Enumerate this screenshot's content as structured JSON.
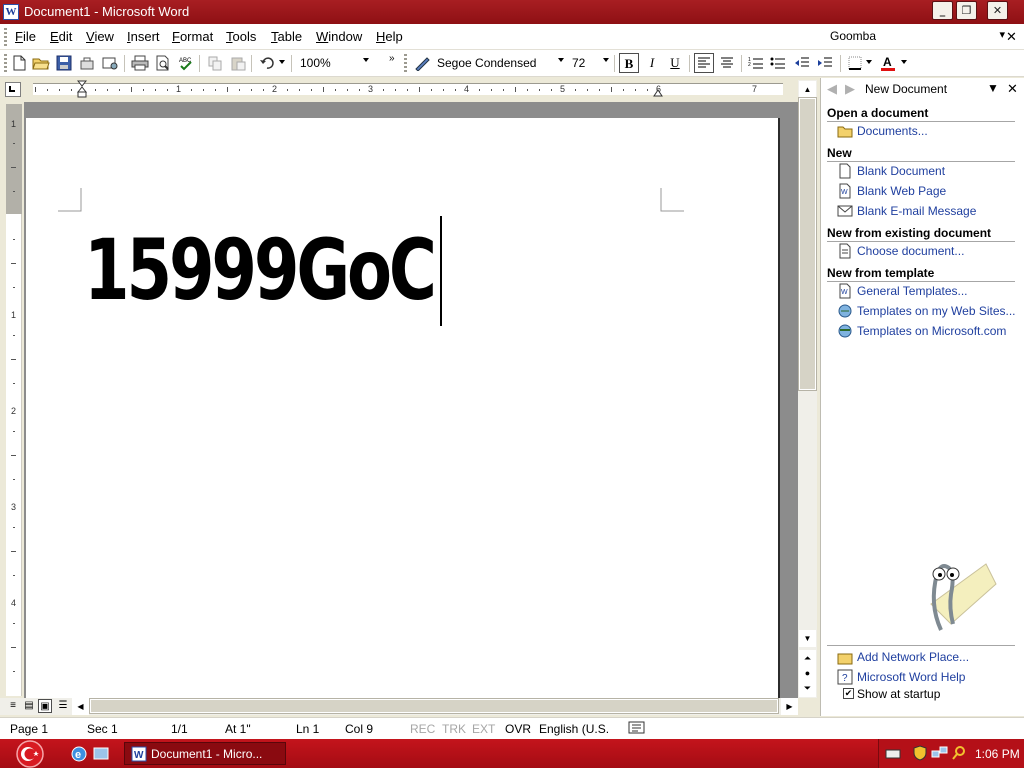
{
  "window": {
    "title": "Document1 - Microsoft Word",
    "app_icon": "W"
  },
  "menu": {
    "items": [
      "File",
      "Edit",
      "View",
      "Insert",
      "Format",
      "Tools",
      "Table",
      "Window",
      "Help"
    ],
    "help_box_value": "Goomba"
  },
  "toolbar": {
    "zoom": "100%",
    "font_name": "Segoe Condensed",
    "font_size": "72",
    "bold_label": "B",
    "italic_label": "I",
    "underline_label": "U"
  },
  "ruler": {
    "numbers": [
      "1",
      "2",
      "3",
      "4",
      "5",
      "6",
      "7"
    ],
    "vnumbers": [
      "1",
      "1",
      "2",
      "3",
      "4"
    ]
  },
  "document": {
    "text": "15999GoC"
  },
  "taskpane": {
    "title": "New Document",
    "sections": {
      "open": "Open a document",
      "new": "New",
      "existing": "New from existing document",
      "template": "New from template"
    },
    "links": {
      "documents": "Documents...",
      "blank_document": "Blank Document",
      "blank_web_page": "Blank Web Page",
      "blank_email": "Blank E-mail Message",
      "choose_document": "Choose document...",
      "general_templates": "General Templates...",
      "templates_web_sites": "Templates on my Web Sites...",
      "templates_microsoft": "Templates on Microsoft.com",
      "add_network_place": "Add Network Place...",
      "word_help": "Microsoft Word Help"
    },
    "show_at_startup": "Show at startup"
  },
  "statusbar": {
    "page": "Page 1",
    "sec": "Sec 1",
    "pages": "1/1",
    "at": "At 1\"",
    "ln": "Ln 1",
    "col": "Col 9",
    "rec": "REC",
    "trk": "TRK",
    "ext": "EXT",
    "ovr": "OVR",
    "language": "English (U.S."
  },
  "taskbar": {
    "word_task": "Document1 - Micro...",
    "clock": "1:06 PM"
  },
  "colors": {
    "titlebar": "#a81e22",
    "taskbar": "#c4141c",
    "link": "#1f3f9f"
  },
  "icons": [
    "word-app-icon",
    "new-icon",
    "open-icon",
    "save-icon",
    "permission-icon",
    "print-icon",
    "print-preview-icon",
    "spelling-icon",
    "copy-icon",
    "paste-icon",
    "undo-icon",
    "align-left-icon",
    "center-icon",
    "numbering-icon",
    "bullets-icon",
    "decrease-indent-icon",
    "increase-indent-icon",
    "borders-icon",
    "font-color-icon",
    "clippy-icon",
    "start-icon",
    "ie-icon",
    "clock"
  ]
}
